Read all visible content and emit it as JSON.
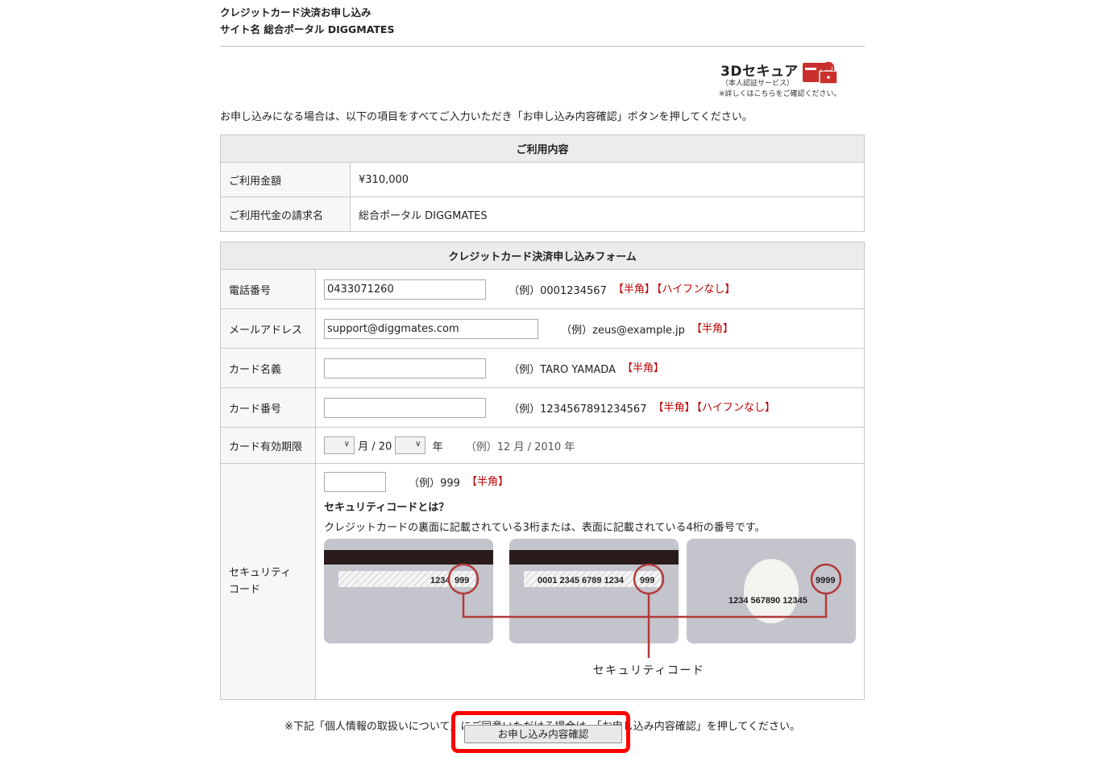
{
  "header": {
    "title": "クレジットカード決済お申し込み",
    "site": "サイト名 総合ポータル DIGGMATES"
  },
  "secure": {
    "title": "3Dセキュア",
    "sub": "（本人認証サービス）",
    "note": "※詳しくはこちらをご確認ください。"
  },
  "intro": "お申し込みになる場合は、以下の項目をすべてご入力いただき「お申し込み内容確認」ボタンを押してください。",
  "usage": {
    "caption": "ご利用内容",
    "rows": [
      {
        "label": "ご利用金額",
        "value": "¥310,000"
      },
      {
        "label": "ご利用代金の請求名",
        "value": "総合ポータル DIGGMATES"
      }
    ]
  },
  "form": {
    "caption": "クレジットカード決済申し込みフォーム",
    "phone": {
      "label": "電話番号",
      "value": "0433071260",
      "example": "（例）0001234567",
      "tag1": "【半角】",
      "tag2": "【ハイフンなし】"
    },
    "email": {
      "label": "メールアドレス",
      "value": "support@diggmates.com",
      "example": "（例）zeus@example.jp",
      "tag1": "【半角】"
    },
    "card_name": {
      "label": "カード名義",
      "value": "",
      "example": "（例）TARO YAMADA",
      "tag1": "【半角】"
    },
    "card_number": {
      "label": "カード番号",
      "value": "",
      "example": "（例）1234567891234567",
      "tag1": "【半角】",
      "tag2": "【ハイフンなし】"
    },
    "expiry": {
      "label": "カード有効期限",
      "month_unit": "月 / 20",
      "year_unit": "年",
      "example": "（例）12 月 / 2010 年"
    },
    "security": {
      "label_line1": "セキュリティ",
      "label_line2": "コード",
      "value": "",
      "example": "（例）999",
      "tag1": "【半角】",
      "what": "セキュリティコードとは？",
      "desc": "クレジットカードの裏面に記載されている3桁または、表面に記載されている4桁の番号です。",
      "card1": {
        "number": "1234",
        "code": "999"
      },
      "card2": {
        "number": "0001 2345 6789 1234",
        "code": "999"
      },
      "card3": {
        "number": "1234 567890 12345",
        "code": "9999"
      },
      "caption": "セキュリティコード"
    }
  },
  "consent": "※下記「個人情報の取扱いについて」にご同意いただける場合は、「お申し込み内容確認」を押してください。",
  "submit_label": "お申し込み内容確認",
  "colors": {
    "required": "#c00000",
    "highlight": "#ff0000",
    "card": "#c4c4cc",
    "circle": "#b23a3a"
  }
}
